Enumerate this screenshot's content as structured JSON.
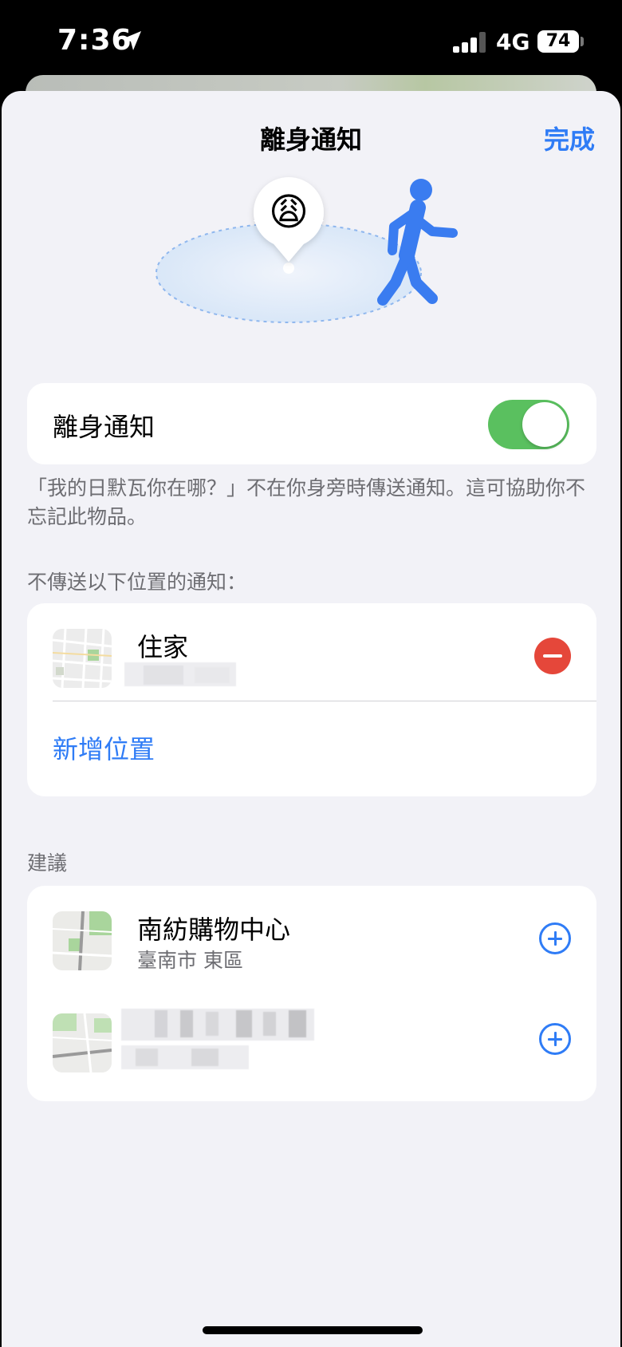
{
  "status_bar": {
    "time": "7:36",
    "network": "4G",
    "battery": "74"
  },
  "nav": {
    "title": "離身通知",
    "done_label": "完成"
  },
  "illustration": {
    "emoji": "😩"
  },
  "toggle_row": {
    "label": "離身通知",
    "state": "on"
  },
  "description": "「我的日默瓦你在哪？」不在你身旁時傳送通知。這可協助你不忘記此物品。",
  "exclude_section": {
    "header": "不傳送以下位置的通知：",
    "locations": [
      {
        "title": "住家"
      }
    ],
    "add_label": "新增位置"
  },
  "suggestions_section": {
    "header": "建議",
    "items": [
      {
        "title": "南紡購物中心",
        "subtitle": "臺南市 東區"
      }
    ]
  },
  "colors": {
    "accent": "#2f7cf6",
    "toggle_on": "#5ac05f",
    "remove": "#e5473a",
    "background": "#f2f2f7"
  }
}
